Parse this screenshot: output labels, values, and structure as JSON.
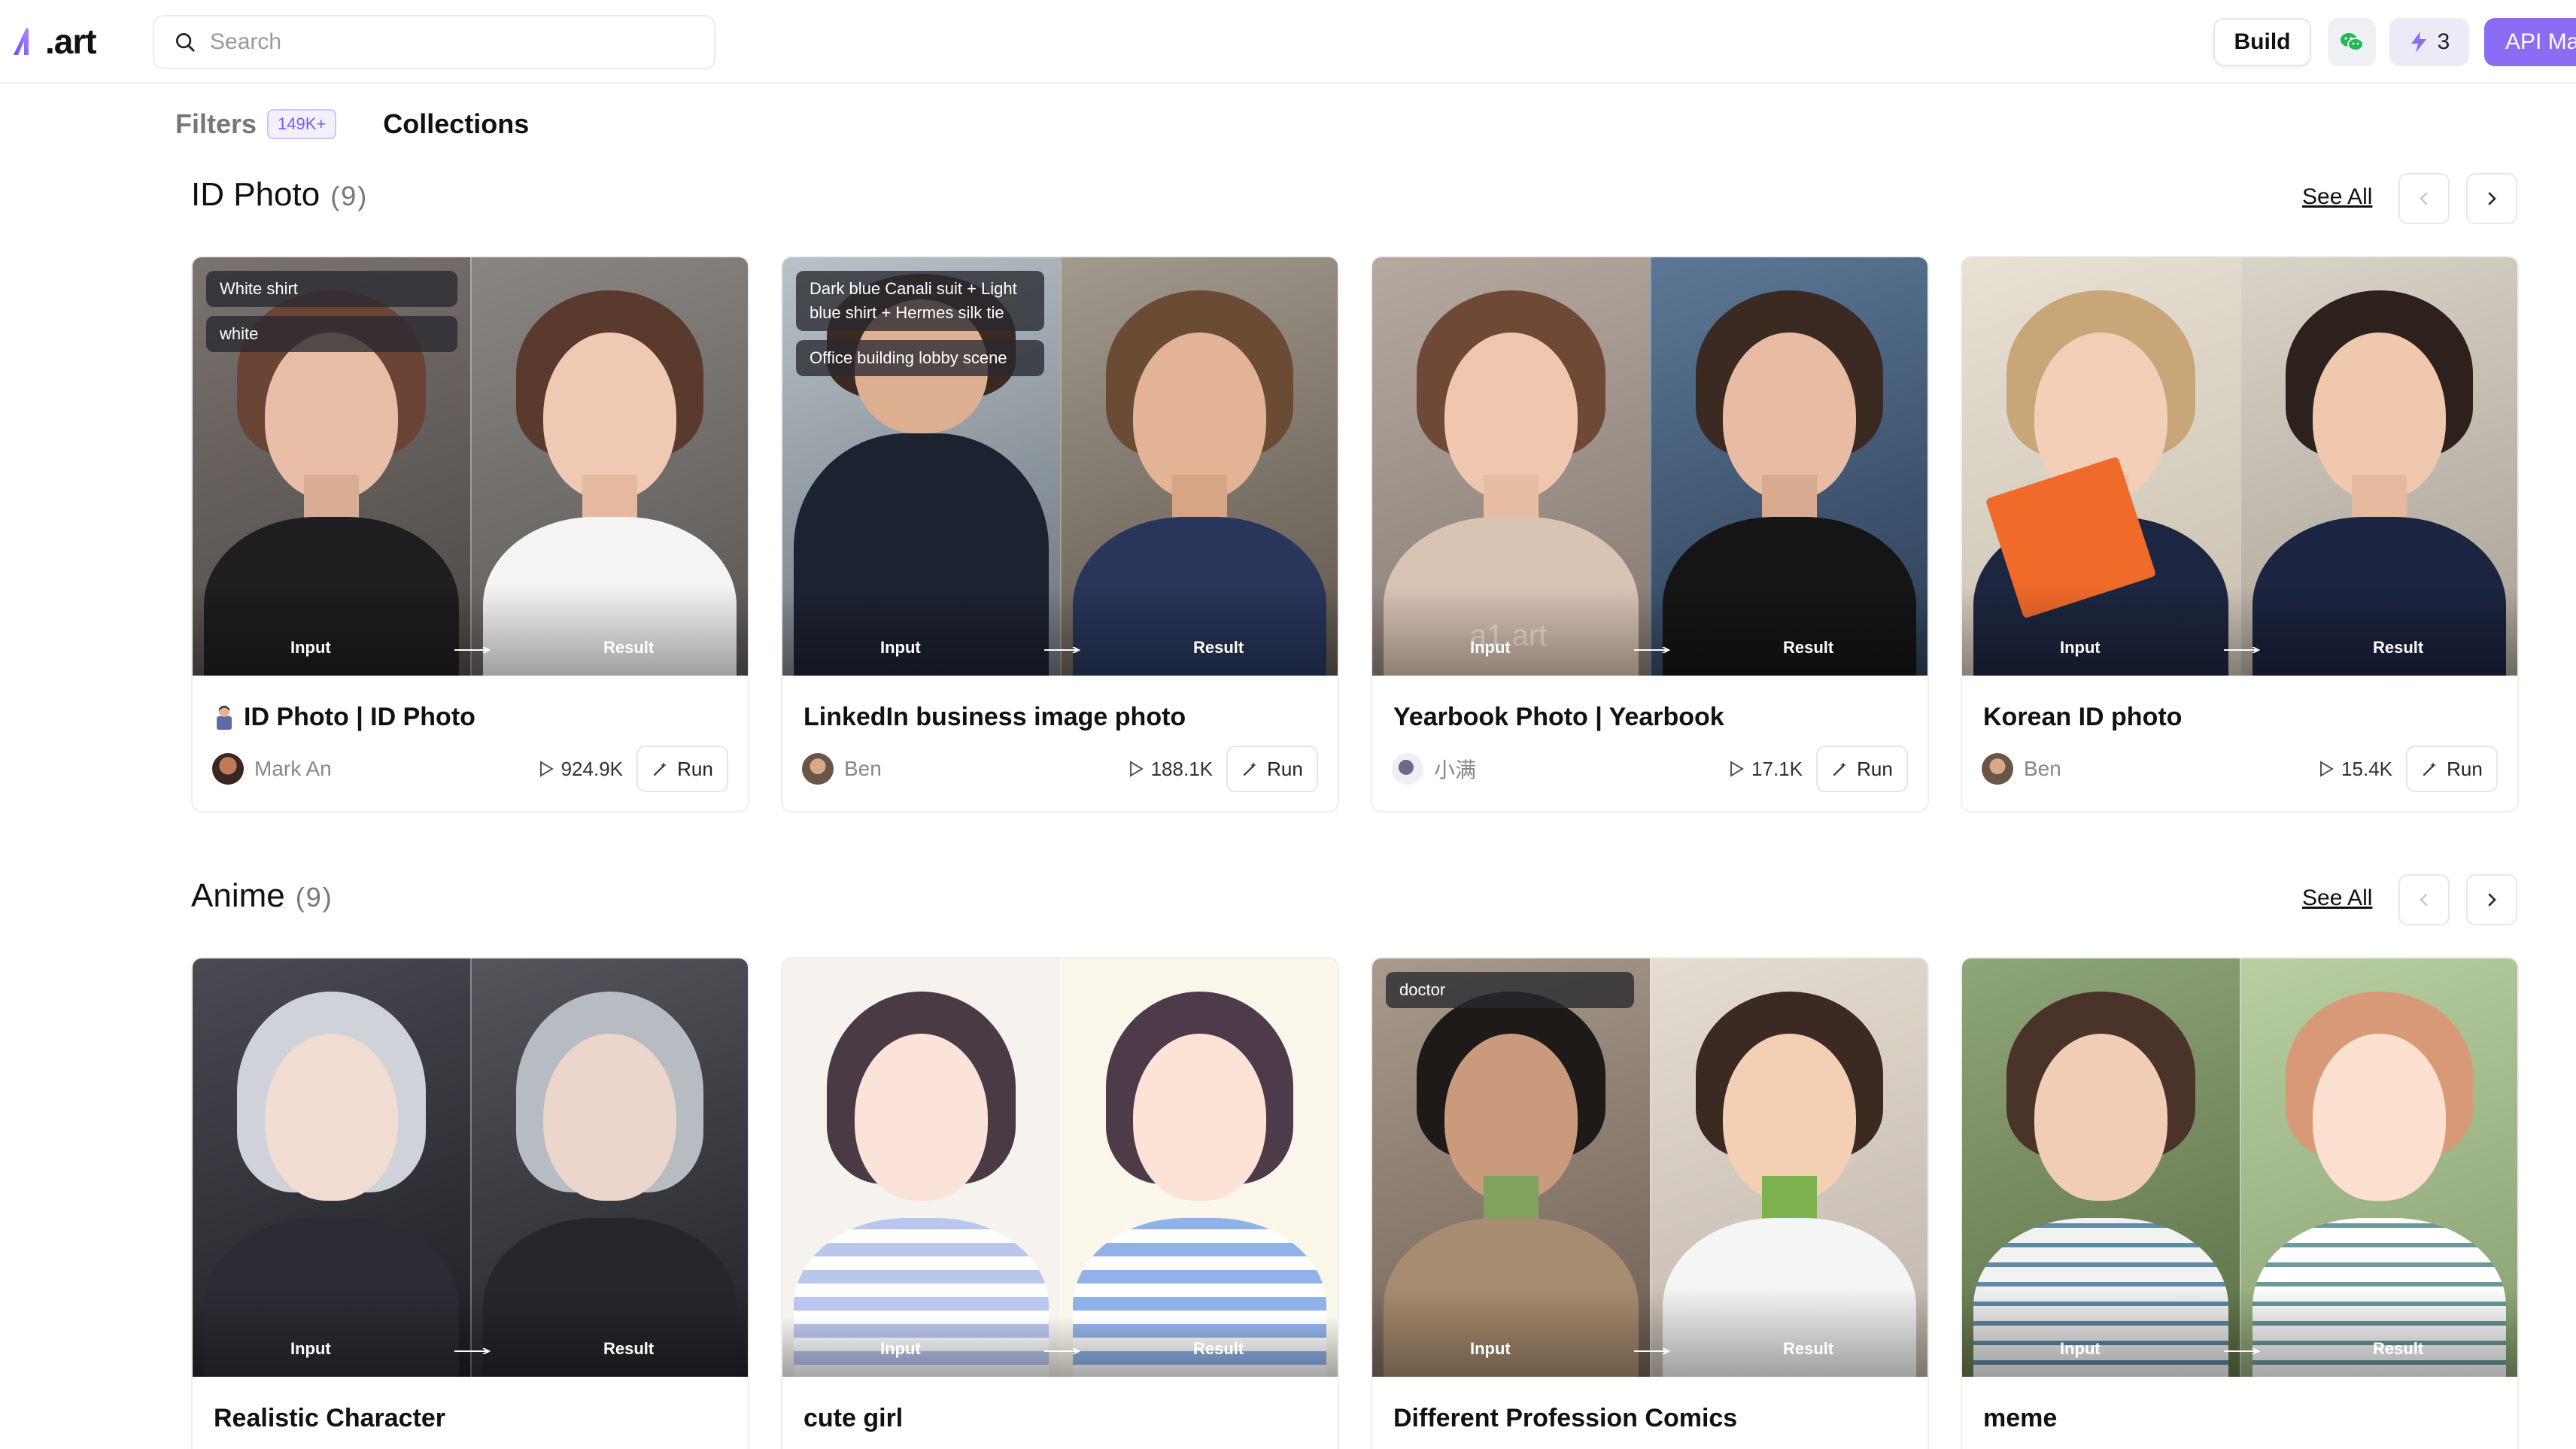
{
  "header": {
    "logo_text": ".art",
    "search_placeholder": "Search",
    "build_label": "Build",
    "credits_count": "3",
    "api_label": "API Ma"
  },
  "subnav": {
    "filters_label": "Filters",
    "filters_badge": "149K+",
    "collections_label": "Collections"
  },
  "sections": [
    {
      "name": "ID Photo",
      "count": "(9)",
      "see_all": "See All",
      "cards": [
        {
          "title": "ID Photo | ID Photo",
          "author": "Mark An",
          "runs": "924.9K",
          "run_label": "Run",
          "input_label": "Input",
          "result_label": "Result",
          "tags": [
            "White shirt",
            "white"
          ]
        },
        {
          "title": "LinkedIn business image photo",
          "author": "Ben",
          "runs": "188.1K",
          "run_label": "Run",
          "input_label": "Input",
          "result_label": "Result",
          "tags": [
            "Dark blue Canali suit + Light blue shirt + Hermes silk tie",
            "Office building lobby scene"
          ]
        },
        {
          "title": "Yearbook Photo | Yearbook",
          "author": "小满",
          "runs": "17.1K",
          "run_label": "Run",
          "input_label": "Input",
          "result_label": "Result",
          "watermark": "a1.art"
        },
        {
          "title": "Korean ID photo",
          "author": "Ben",
          "runs": "15.4K",
          "run_label": "Run",
          "input_label": "Input",
          "result_label": "Result"
        }
      ]
    },
    {
      "name": "Anime",
      "count": "(9)",
      "see_all": "See All",
      "cards": [
        {
          "title": "Realistic Character",
          "input_label": "Input",
          "result_label": "Result"
        },
        {
          "title": "cute girl",
          "input_label": "Input",
          "result_label": "Result"
        },
        {
          "title": "Different Profession Comics",
          "input_label": "Input",
          "result_label": "Result",
          "tags": [
            "doctor"
          ]
        },
        {
          "title": "meme",
          "input_label": "Input",
          "result_label": "Result"
        }
      ]
    }
  ],
  "colors": {
    "accent": "#8a6cf5",
    "badge_text": "#7a5cf0"
  }
}
